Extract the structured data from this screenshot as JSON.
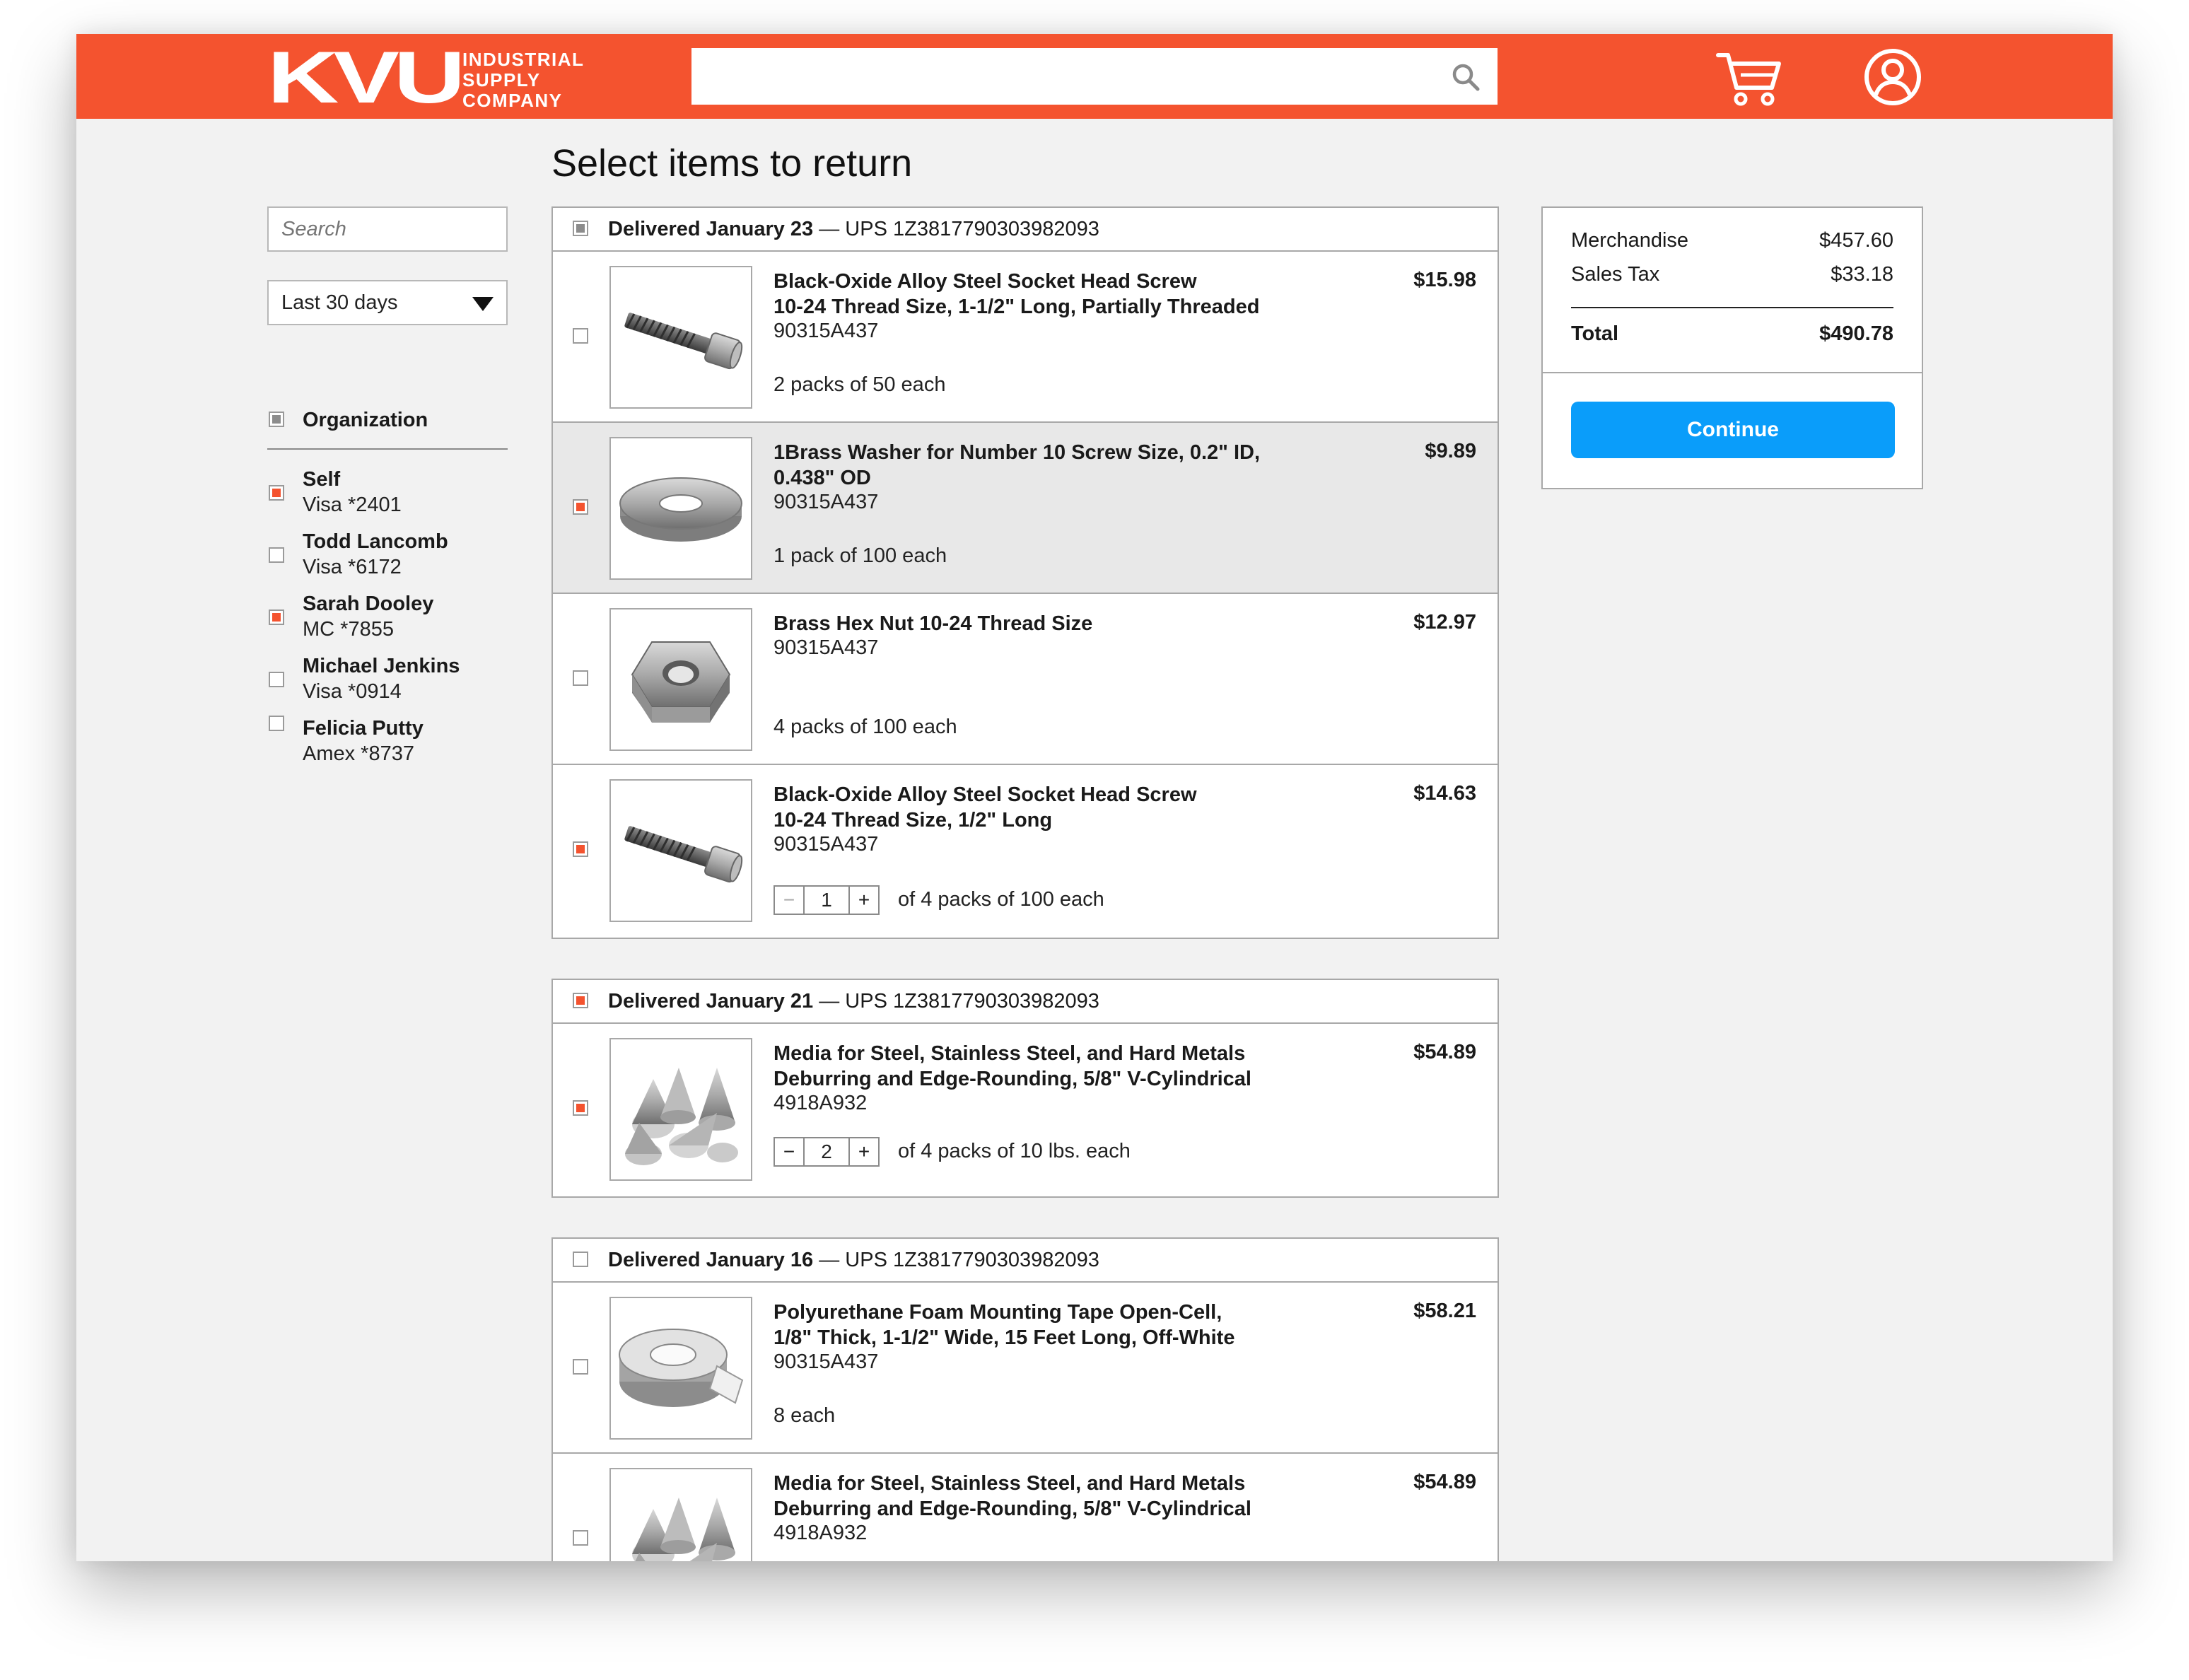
{
  "header": {
    "logo_letters": "KVU",
    "logo_words": [
      "INDUSTRIAL",
      "SUPPLY",
      "COMPANY"
    ],
    "brand_color": "#f4532f",
    "search_placeholder": "",
    "icons": [
      "search-icon",
      "cart-icon",
      "user-icon"
    ]
  },
  "page_title": "Select items to return",
  "sidebar": {
    "search_placeholder": "Search",
    "date_filter": "Last 30 days",
    "org_label": "Organization",
    "people": [
      {
        "name": "Self",
        "card": "Visa *2401",
        "checked": true
      },
      {
        "name": "Todd Lancomb",
        "card": "Visa *6172",
        "checked": false
      },
      {
        "name": "Sarah Dooley",
        "card": "MC *7855",
        "checked": true
      },
      {
        "name": "Michael Jenkins",
        "card": "Visa *0914",
        "checked": false
      },
      {
        "name": "Felicia Putty",
        "card": "Amex *8737",
        "checked": false
      }
    ]
  },
  "groups": [
    {
      "date": "Delivered January 23",
      "tracking": " — UPS 1Z3817790303982093",
      "state": "mixed",
      "items": [
        {
          "title_1": "Black-Oxide Alloy Steel Socket Head Screw",
          "title_2": "10-24 Thread Size, 1-1/2\" Long, Partially Threaded",
          "sku": "90315A437",
          "qty": "2 packs of 50 each",
          "price": "$15.98",
          "checked": false,
          "image": "screw-image"
        },
        {
          "title_1": "1Brass Washer for Number 10 Screw Size, 0.2\" ID,",
          "title_2": "0.438\" OD",
          "sku": "90315A437",
          "qty": "1 pack of 100 each",
          "price": "$9.89",
          "checked": true,
          "image": "washer-image"
        },
        {
          "title_1": "Brass Hex Nut 10-24 Thread Size",
          "title_2": "",
          "sku": "90315A437",
          "qty": "4 packs of 100 each",
          "price": "$12.97",
          "checked": false,
          "image": "hex-nut-image"
        },
        {
          "title_1": "Black-Oxide Alloy Steel Socket Head Screw",
          "title_2": "10-24 Thread Size, 1/2\" Long",
          "sku": "90315A437",
          "stepper": {
            "minus": "−",
            "value": "1",
            "plus": "+",
            "label": "of 4 packs of 100 each"
          },
          "price": "$14.63",
          "checked": true,
          "image": "screw-image"
        }
      ]
    },
    {
      "date": "Delivered January 21",
      "tracking": " — UPS 1Z3817790303982093",
      "state": "on",
      "items": [
        {
          "title_1": "Media for Steel, Stainless Steel, and Hard Metals",
          "title_2": "Deburring and Edge-Rounding, 5/8\" V-Cylindrical",
          "sku": "4918A932",
          "stepper": {
            "minus": "−",
            "value": "2",
            "plus": "+",
            "label": "of 4 packs of 10 lbs. each"
          },
          "price": "$54.89",
          "checked": true,
          "image": "cone-media-image"
        }
      ]
    },
    {
      "date": "Delivered January 16",
      "tracking": " — UPS 1Z3817790303982093",
      "state": "off",
      "items": [
        {
          "title_1": "Polyurethane Foam Mounting Tape Open-Cell,",
          "title_2": "1/8\" Thick, 1-1/2\" Wide, 15 Feet Long, Off-White",
          "sku": "90315A437",
          "qty": "8 each",
          "price": "$58.21",
          "checked": false,
          "image": "foam-tape-image"
        },
        {
          "title_1": "Media for Steel, Stainless Steel, and Hard Metals",
          "title_2": "Deburring and Edge-Rounding, 5/8\" V-Cylindrical",
          "sku": "4918A932",
          "qty": "",
          "price": "$54.89",
          "checked": false,
          "image": "cone-media-image"
        }
      ]
    }
  ],
  "summary": {
    "merchandise_label": "Merchandise",
    "merchandise_value": "$457.60",
    "tax_label": "Sales Tax",
    "tax_value": "$33.18",
    "total_label": "Total",
    "total_value": "$490.78",
    "continue_label": "Continue",
    "continue_color": "#0a9dfa"
  }
}
